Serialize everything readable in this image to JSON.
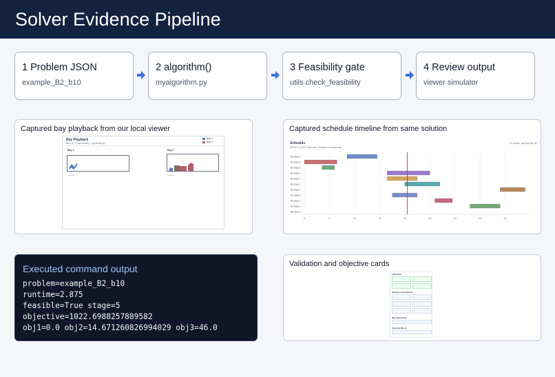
{
  "header": {
    "title": "Solver Evidence Pipeline"
  },
  "steps": [
    {
      "title": "1 Problem JSON",
      "subtitle": "example_B2_b10"
    },
    {
      "title": "2 algorithm()",
      "subtitle": "myalgorithm.py"
    },
    {
      "title": "3 Feasibility gate",
      "subtitle": "utils.check_feasibility"
    },
    {
      "title": "4 Review output",
      "subtitle": "viewer simulator"
    }
  ],
  "panels": {
    "bay": {
      "title": "Captured bay playback from our local viewer",
      "inner_title": "Bay Playback",
      "inner_sub": "Bay 2/1 2 wait blocks, 1 generator(s)",
      "legend": [
        "Bay 1",
        "Bay 2"
      ],
      "bay1_label": "Bay 1",
      "bay2_label": "Bay 2",
      "bay1_caption": "Loaded",
      "bay2_caption": "Loaded",
      "colors": {
        "bay1": "#5b78b8",
        "bay2": "#b35c6a"
      }
    },
    "schedule": {
      "title": "Captured schedule timeline from same solution",
      "inner_title": "Schedule",
      "inner_sub": "ENTRY to EXIT intervals. Red line is current day.",
      "inner_right": "10 blocks, peri est day 32",
      "rows": [
        "B1 Bay 2",
        "B1 Bay 2",
        "B1 Bay 2",
        "B1 Bay 1",
        "B1 Bay 1",
        "B1 Bay 1",
        "B1 Bay 1",
        "B1 Bay 2",
        "B1 Bay 2",
        "B1 Bay 1",
        "B1 Bay 2"
      ],
      "ticks": [
        "0",
        "5",
        "10",
        "15",
        "20",
        "25",
        "30",
        "35",
        "40"
      ]
    },
    "validation": {
      "title": "Validation and objective cards",
      "sections": [
        "Validation",
        "Objective Breakdown",
        "Bay Operations",
        "Selected Block"
      ]
    }
  },
  "terminal": {
    "title": "Executed command output",
    "lines": [
      "problem=example_B2_b10",
      "runtime=2.875",
      "feasible=True stage=5",
      "objective=1022.6988257889582",
      "obj1=0.0 obj2=14.671260826994029 obj3=46.0"
    ]
  },
  "chart_data": {
    "type": "gantt",
    "title": "Schedule",
    "x_ticks": [
      0,
      5,
      10,
      15,
      20,
      25,
      30,
      35,
      40
    ],
    "xlim": [
      0,
      45
    ],
    "current_day": 20.5,
    "rows": [
      {
        "label": "B1 Bay 2",
        "start": 8.5,
        "end": 14.5,
        "color": "#6f8fc9"
      },
      {
        "label": "B1 Bay 2",
        "start": 0,
        "end": 6.5,
        "color": "#c77272"
      },
      {
        "label": "B1 Bay 2",
        "start": 3.5,
        "end": 6,
        "color": "#6fa87d"
      },
      {
        "label": "B1 Bay 1",
        "start": 16.5,
        "end": 25,
        "color": "#9a7ccf"
      },
      {
        "label": "B1 Bay 1",
        "start": 16.5,
        "end": 22.5,
        "color": "#d1a561"
      },
      {
        "label": "B1 Bay 1",
        "start": 20,
        "end": 27,
        "color": "#5aa8b0"
      },
      {
        "label": "B1 Bay 1",
        "start": 39,
        "end": 44,
        "color": "#b58860"
      },
      {
        "label": "B1 Bay 2",
        "start": 17.5,
        "end": 22.5,
        "color": "#7e8fc4"
      },
      {
        "label": "B1 Bay 2",
        "start": 26,
        "end": 29.5,
        "color": "#c66a7c"
      },
      {
        "label": "B1 Bay 1",
        "start": 33,
        "end": 39,
        "color": "#79a878"
      },
      {
        "label": "B1 Bay 2",
        "start": 0,
        "end": 0,
        "color": "#999999"
      }
    ]
  }
}
